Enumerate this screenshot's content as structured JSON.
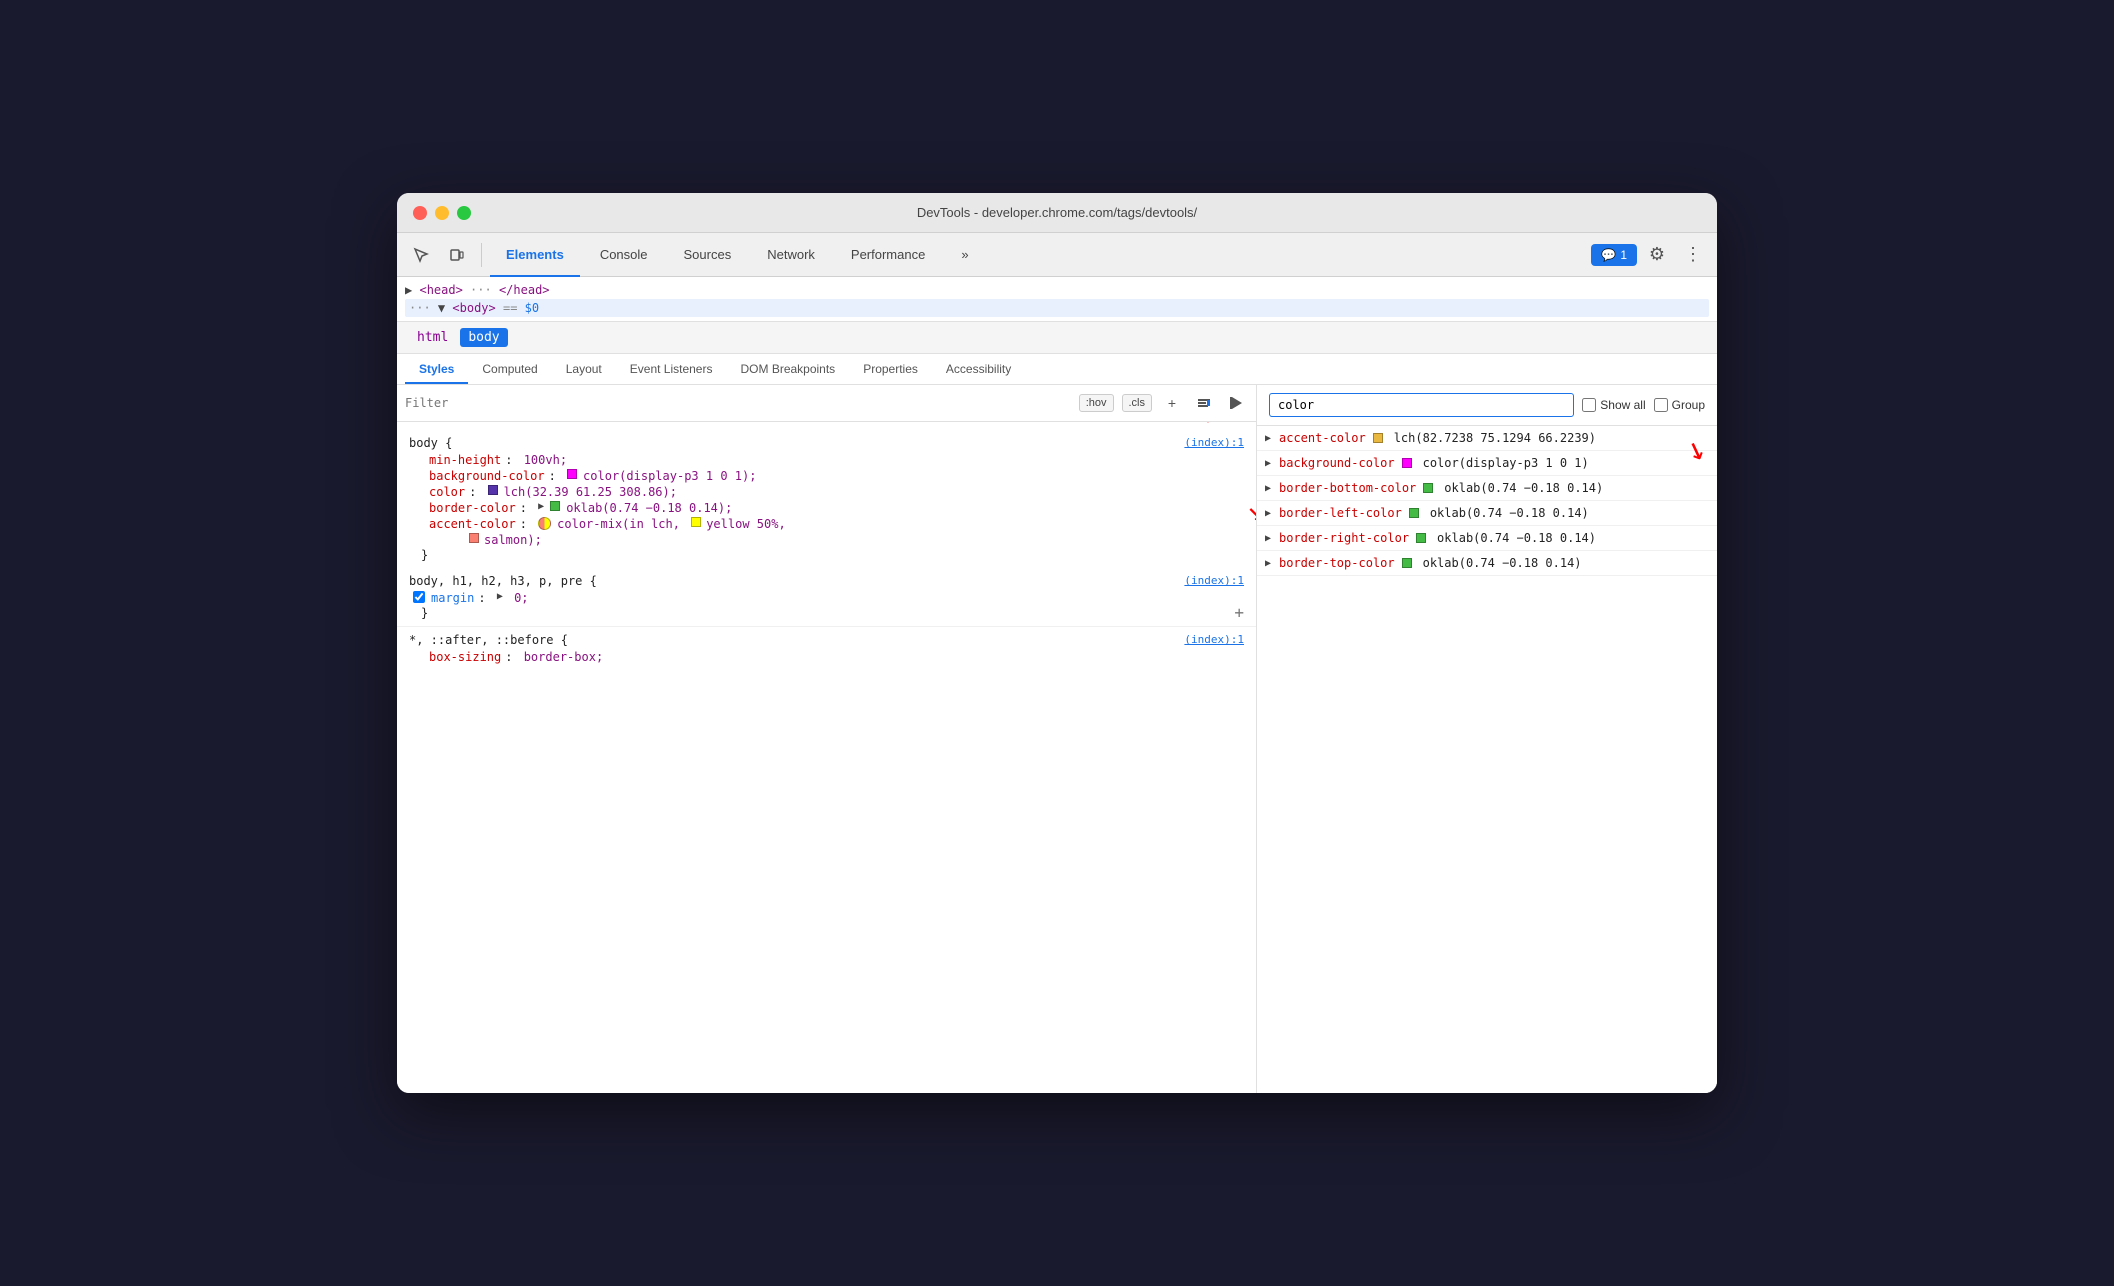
{
  "window": {
    "title": "DevTools - developer.chrome.com/tags/devtools/"
  },
  "toolbar": {
    "tabs": [
      {
        "label": "Elements",
        "active": true
      },
      {
        "label": "Console",
        "active": false
      },
      {
        "label": "Sources",
        "active": false
      },
      {
        "label": "Network",
        "active": false
      },
      {
        "label": "Performance",
        "active": false
      },
      {
        "label": "»",
        "active": false
      }
    ],
    "notification": "💬 1",
    "more_tabs_label": "»"
  },
  "dom": {
    "head_line": "▶ <head> ··· </head>",
    "body_line": "··· ▼ <body> == $0"
  },
  "tag_selector": {
    "tags": [
      "html",
      "body"
    ]
  },
  "panel_tabs": [
    {
      "label": "Styles",
      "active": true
    },
    {
      "label": "Computed",
      "active": false
    },
    {
      "label": "Layout",
      "active": false
    },
    {
      "label": "Event Listeners",
      "active": false
    },
    {
      "label": "DOM Breakpoints",
      "active": false
    },
    {
      "label": "Properties",
      "active": false
    },
    {
      "label": "Accessibility",
      "active": false
    }
  ],
  "filter": {
    "placeholder": "Filter",
    "hov_label": ":hov",
    "cls_label": ".cls"
  },
  "css_rules": [
    {
      "selector": "body {",
      "source": "(index):1",
      "properties": [
        {
          "name": "min-height",
          "value": "100vh;",
          "color": null,
          "checked": false
        },
        {
          "name": "background-color",
          "value": "color(display-p3 1 0 1);",
          "color": "#ff00ff",
          "checked": false
        },
        {
          "name": "color",
          "value": "lch(32.39 61.25 308.86);",
          "color": "#5533aa",
          "checked": false
        },
        {
          "name": "border-color",
          "value": "oklab(0.74 −0.18 0.14);",
          "color": "#44bb44",
          "checked": false,
          "has_arrow": true
        },
        {
          "name": "accent-color",
          "value": "color-mix(in lch, yellow 50%,\n    salmon);",
          "color": "mixed",
          "checked": false
        }
      ],
      "close": "}"
    },
    {
      "selector": "body, h1, h2, h3, p, pre {",
      "source": "(index):1",
      "properties": [
        {
          "name": "margin",
          "value": "0;",
          "color": null,
          "checked": true,
          "has_arrow": true
        }
      ],
      "close": "}"
    },
    {
      "selector": "*, ::after, ::before {",
      "source": "(index):1",
      "properties": [
        {
          "name": "box-sizing",
          "value": "border-box;",
          "color": null,
          "checked": false
        }
      ],
      "close": ""
    }
  ],
  "computed": {
    "filter_value": "color",
    "show_all_label": "Show all",
    "group_label": "Group",
    "items": [
      {
        "prop": "accent-color",
        "value": "lch(82.7238 75.1294 66.2239)",
        "color": "#e8b840",
        "has_arrow": true
      },
      {
        "prop": "background-color",
        "value": "color(display-p3 1 0 1)",
        "color": "#ff00ff",
        "has_arrow": true
      },
      {
        "prop": "border-bottom-color",
        "value": "oklab(0.74 −0.18 0.14)",
        "color": "#44bb44",
        "has_arrow": true
      },
      {
        "prop": "border-left-color",
        "value": "oklab(0.74 −0.18 0.14)",
        "color": "#44bb44",
        "has_arrow": true
      },
      {
        "prop": "border-right-color",
        "value": "oklab(0.74 −0.18 0.14)",
        "color": "#44bb44",
        "has_arrow": true
      },
      {
        "prop": "border-top-color",
        "value": "oklab(0.74 −0.18 0.14)",
        "color": "#44bb44",
        "has_arrow": true
      }
    ]
  }
}
